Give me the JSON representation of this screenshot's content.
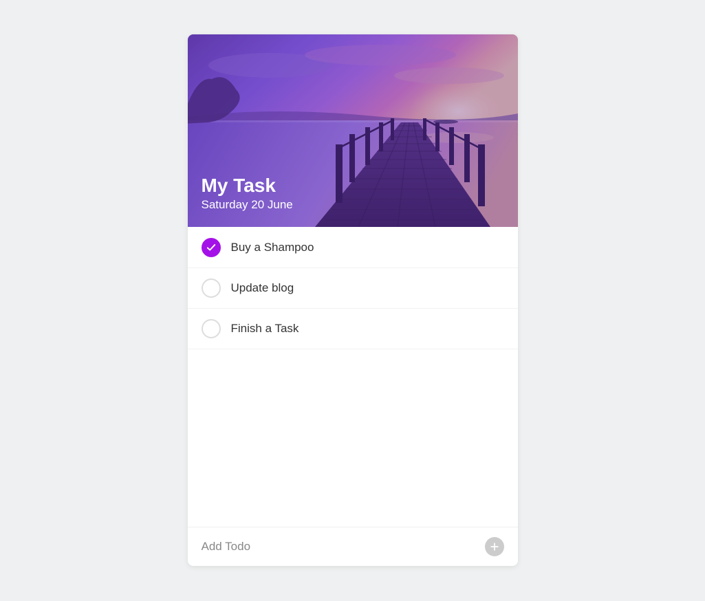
{
  "header": {
    "title": "My Task",
    "date": "Saturday 20 June"
  },
  "tasks": [
    {
      "label": "Buy a Shampoo",
      "done": true
    },
    {
      "label": "Update blog",
      "done": false
    },
    {
      "label": "Finish a Task",
      "done": false
    }
  ],
  "footer": {
    "placeholder": "Add Todo"
  }
}
